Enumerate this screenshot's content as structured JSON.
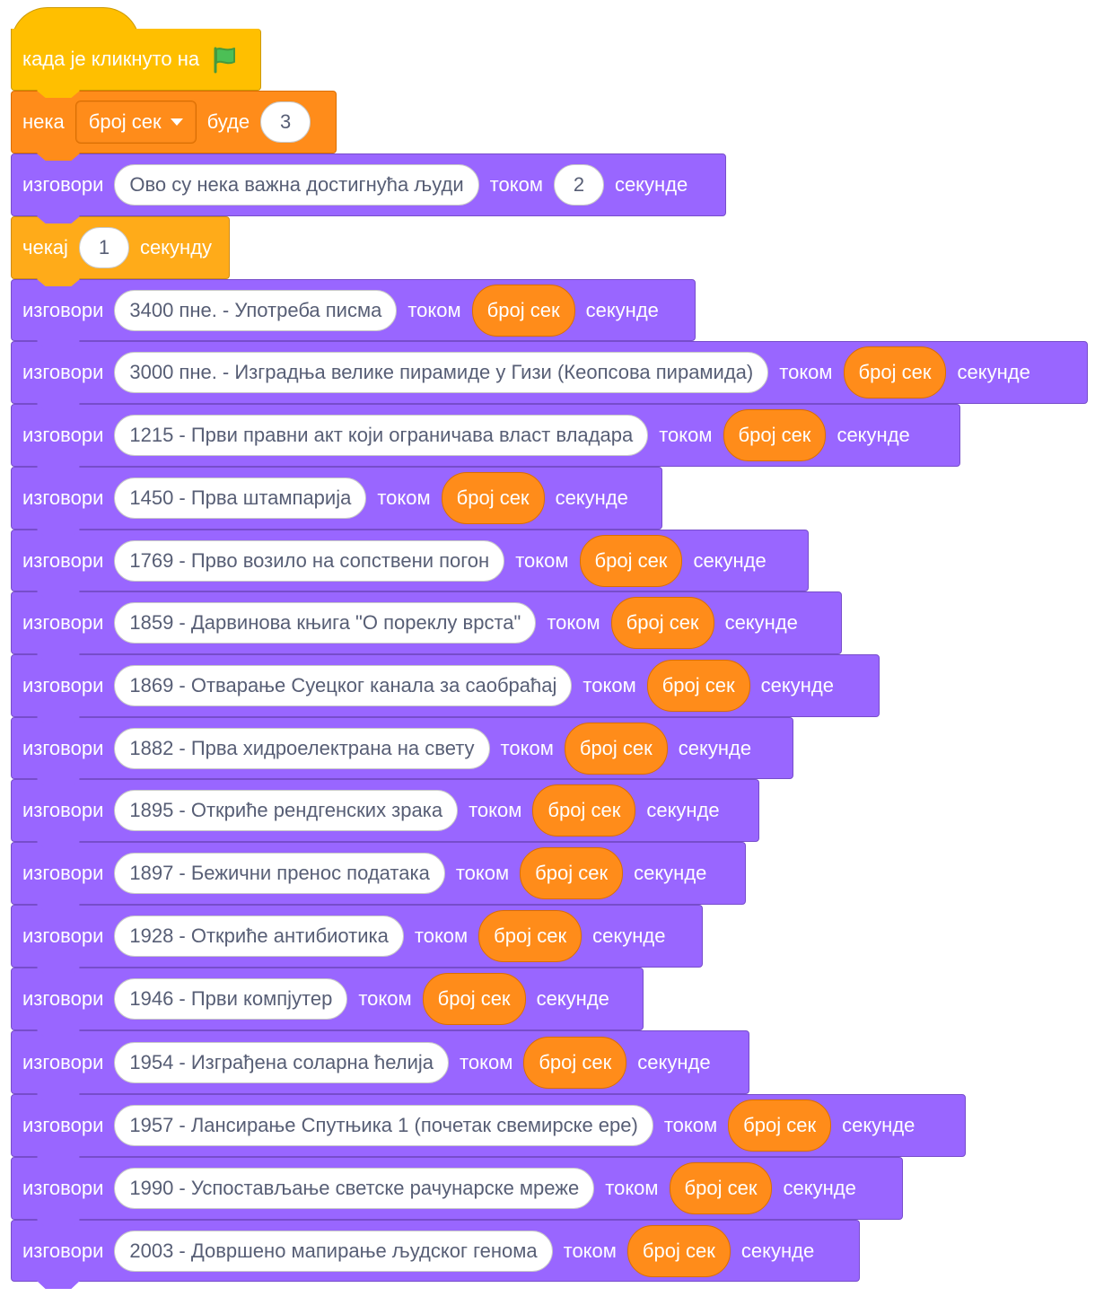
{
  "colors": {
    "looks": "#9966FF",
    "events": "#FFBF00",
    "variables": "#FF8C1A",
    "control": "#FFAB19",
    "flag_green": "#4CBF56"
  },
  "hat_block": {
    "label": "када је кликнуто на",
    "icon": "green-flag-icon"
  },
  "set_block": {
    "label_set": "нека",
    "variable": "број сек",
    "label_to": "буде",
    "value": "3"
  },
  "say_intro": {
    "label_say": "изговори",
    "message": "Ово су нека важна достигнућа људи",
    "label_for": "током",
    "secs": "2",
    "label_seconds": "секунде"
  },
  "wait_block": {
    "label_wait": "чекај",
    "value": "1",
    "label_second": "секунду"
  },
  "say_labels": {
    "say": "изговори",
    "for": "током",
    "variable": "број сек",
    "seconds": "секунде"
  },
  "milestones": [
    "3400 пне. - Употреба писма",
    "3000 пне. - Изградња велике пирамиде у Гизи (Кеопсова пирамида)",
    "1215 - Први правни акт који ограничава власт владара",
    "1450 - Прва штампарија",
    "1769 - Прво возило на сопствени погон",
    "1859 - Дарвинова књига \"О пореклу врста\"",
    "1869 - Отварање Суецког канала за саобраћај",
    "1882 - Прва хидроелектрана на свету",
    "1895 - Откриће рендгенских зрака",
    "1897 - Бежични пренос података",
    "1928 - Откриће антибиотика",
    "1946 - Први компјутер",
    "1954 - Изграђена соларна ћелија",
    "1957 - Лансирање Спутњика 1 (почетак свемирске ере)",
    "1990 - Успостављање светске рачунарске мреже",
    "2003 - Довршено мапирање људског генома"
  ]
}
